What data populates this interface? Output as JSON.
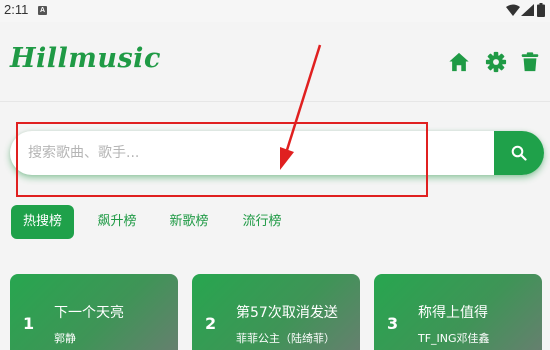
{
  "status_bar": {
    "time": "2:11",
    "notification": "A"
  },
  "app": {
    "logo": "Hillmusic"
  },
  "search": {
    "placeholder": "搜索歌曲、歌手..."
  },
  "tabs": [
    {
      "label": "热搜榜",
      "active": true
    },
    {
      "label": "飙升榜",
      "active": false
    },
    {
      "label": "新歌榜",
      "active": false
    },
    {
      "label": "流行榜",
      "active": false
    }
  ],
  "songs": [
    {
      "rank": "1",
      "title": "下一个天亮",
      "artist": "郭静"
    },
    {
      "rank": "2",
      "title": "第57次取消发送",
      "artist": "菲菲公主（陆绮菲）"
    },
    {
      "rank": "3",
      "title": "称得上值得",
      "artist": "TF_ING邓佳鑫"
    }
  ],
  "colors": {
    "accent": "#1fa14a",
    "logo": "#1f9a45",
    "annotation": "#e02020",
    "background": "#f4f4f4"
  },
  "icons": [
    "home-icon",
    "gear-icon",
    "trash-icon",
    "search-icon",
    "wifi-icon",
    "signal-icon",
    "battery-icon"
  ]
}
